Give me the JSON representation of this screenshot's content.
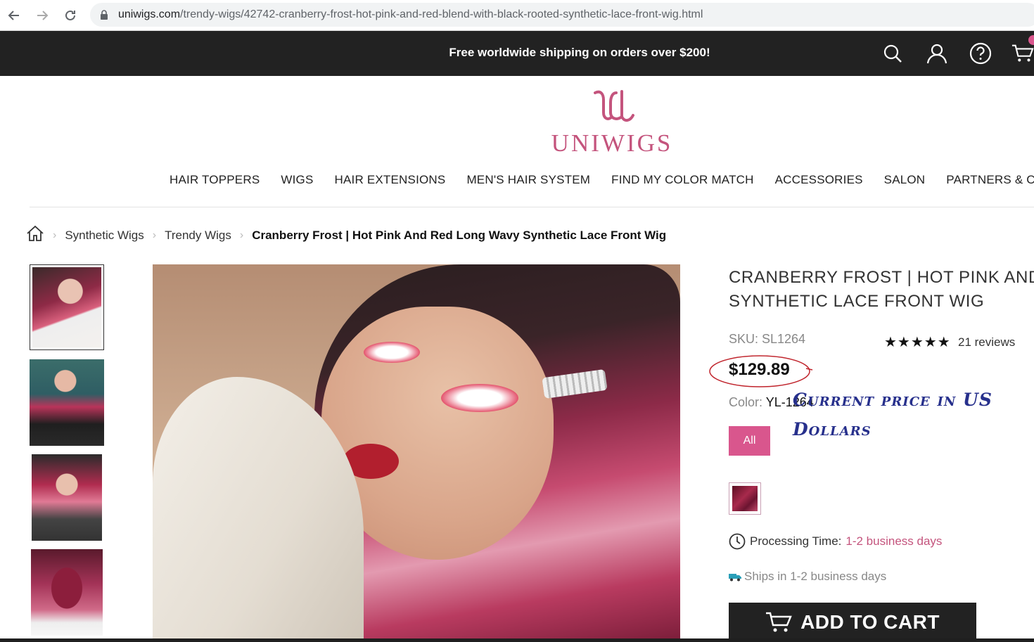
{
  "browser": {
    "url_host": "uniwigs.com",
    "url_path": "/trendy-wigs/42742-cranberry-frost-hot-pink-and-red-blend-with-black-rooted-synthetic-lace-front-wig.html"
  },
  "promo": {
    "text": "Free worldwide shipping on orders over $200!",
    "icons": [
      "search-icon",
      "user-icon",
      "help-icon",
      "cart-icon"
    ]
  },
  "logo": {
    "text": "UNIWIGS"
  },
  "nav": {
    "items": [
      "HAIR TOPPERS",
      "WIGS",
      "HAIR EXTENSIONS",
      "MEN'S HAIR SYSTEM",
      "FIND MY COLOR MATCH",
      "ACCESSORIES",
      "SALON",
      "PARTNERS & CHARIT"
    ]
  },
  "breadcrumb": {
    "items": [
      "Synthetic Wigs",
      "Trendy Wigs"
    ],
    "current": "Cranberry Frost | Hot Pink And Red Long Wavy Synthetic Lace Front Wig"
  },
  "product": {
    "title_line1": "CRANBERRY FROST | HOT PINK AND",
    "title_line2": "SYNTHETIC LACE FRONT WIG",
    "sku": "SKU: SL1264",
    "rating_stars": "★★★★★",
    "reviews": "21 reviews",
    "price": "$129.89",
    "color_label": "Color:",
    "color_value": "YL-1264",
    "all_button": "All",
    "processing_label": "Processing Time:",
    "processing_value": "1-2 business days",
    "ships_text": "Ships in 1-2 business days",
    "add_to_cart": "ADD TO CART"
  },
  "annotation": {
    "text": "Current price in US Dollars",
    "color": "#27308c"
  },
  "colors": {
    "brand_pink": "#c4547d",
    "button_pink": "#d9568d",
    "dark": "#222222"
  }
}
